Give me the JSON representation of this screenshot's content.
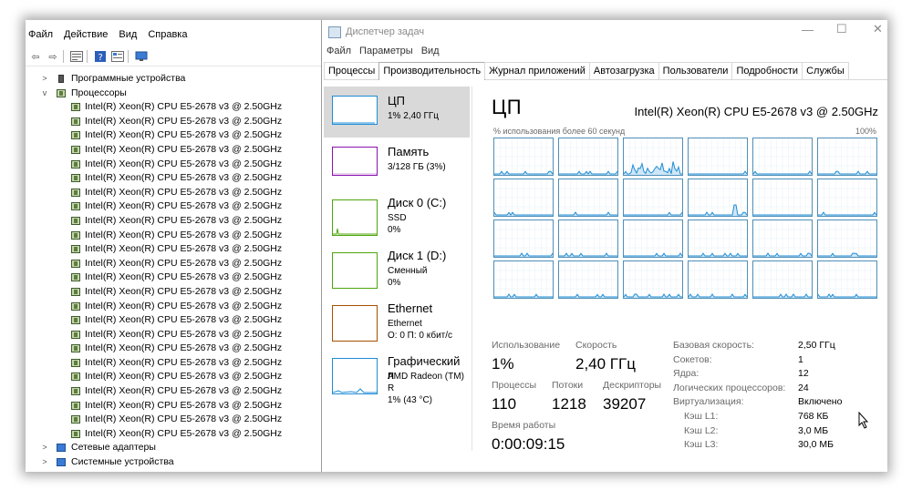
{
  "device_manager": {
    "menu": [
      "Файл",
      "Действие",
      "Вид",
      "Справка"
    ],
    "tree": {
      "programs": "Программные устройства",
      "processors_group": "Процессоры",
      "processors": [
        "Intel(R) Xeon(R) CPU E5-2678 v3 @ 2.50GHz",
        "Intel(R) Xeon(R) CPU E5-2678 v3 @ 2.50GHz",
        "Intel(R) Xeon(R) CPU E5-2678 v3 @ 2.50GHz",
        "Intel(R) Xeon(R) CPU E5-2678 v3 @ 2.50GHz",
        "Intel(R) Xeon(R) CPU E5-2678 v3 @ 2.50GHz",
        "Intel(R) Xeon(R) CPU E5-2678 v3 @ 2.50GHz",
        "Intel(R) Xeon(R) CPU E5-2678 v3 @ 2.50GHz",
        "Intel(R) Xeon(R) CPU E5-2678 v3 @ 2.50GHz",
        "Intel(R) Xeon(R) CPU E5-2678 v3 @ 2.50GHz",
        "Intel(R) Xeon(R) CPU E5-2678 v3 @ 2.50GHz",
        "Intel(R) Xeon(R) CPU E5-2678 v3 @ 2.50GHz",
        "Intel(R) Xeon(R) CPU E5-2678 v3 @ 2.50GHz",
        "Intel(R) Xeon(R) CPU E5-2678 v3 @ 2.50GHz",
        "Intel(R) Xeon(R) CPU E5-2678 v3 @ 2.50GHz",
        "Intel(R) Xeon(R) CPU E5-2678 v3 @ 2.50GHz",
        "Intel(R) Xeon(R) CPU E5-2678 v3 @ 2.50GHz",
        "Intel(R) Xeon(R) CPU E5-2678 v3 @ 2.50GHz",
        "Intel(R) Xeon(R) CPU E5-2678 v3 @ 2.50GHz",
        "Intel(R) Xeon(R) CPU E5-2678 v3 @ 2.50GHz",
        "Intel(R) Xeon(R) CPU E5-2678 v3 @ 2.50GHz",
        "Intel(R) Xeon(R) CPU E5-2678 v3 @ 2.50GHz",
        "Intel(R) Xeon(R) CPU E5-2678 v3 @ 2.50GHz",
        "Intel(R) Xeon(R) CPU E5-2678 v3 @ 2.50GHz",
        "Intel(R) Xeon(R) CPU E5-2678 v3 @ 2.50GHz"
      ],
      "network": "Сетевые адаптеры",
      "system": "Системные устройства"
    }
  },
  "task_manager": {
    "title": "Диспетчер задач",
    "menu": [
      "Файл",
      "Параметры",
      "Вид"
    ],
    "tabs": [
      "Процессы",
      "Производительность",
      "Журнал приложений",
      "Автозагрузка",
      "Пользователи",
      "Подробности",
      "Службы"
    ],
    "active_tab": "Производительность",
    "sidebar": [
      {
        "name": "ЦП",
        "sub1": "1% 2,40 ГГц",
        "sub2": "",
        "sub3": "",
        "color": "#1f8dd6"
      },
      {
        "name": "Память",
        "sub1": "3/128 ГБ (3%)",
        "sub2": "",
        "sub3": "",
        "color": "#8b12ae"
      },
      {
        "name": "Диск 0 (C:)",
        "sub1": "SSD",
        "sub2": "0%",
        "sub3": "",
        "color": "#4da60c"
      },
      {
        "name": "Диск 1 (D:)",
        "sub1": "Сменный",
        "sub2": "0%",
        "sub3": "",
        "color": "#4da60c"
      },
      {
        "name": "Ethernet",
        "sub1": "Ethernet",
        "sub2": "О: 0 П: 0 кбит/с",
        "sub3": "",
        "color": "#a74f01"
      },
      {
        "name": "Графический п",
        "sub1": "AMD Radeon (TM) R",
        "sub2": "1% (43 °C)",
        "sub3": "",
        "color": "#1f8dd6"
      }
    ],
    "cpu": {
      "title": "ЦП",
      "model": "Intel(R) Xeon(R) CPU E5-2678 v3 @ 2.50GHz",
      "usage_label": "% использования более 60 секунд",
      "usage_max": "100%",
      "cores": 24,
      "stats": {
        "usage_label": "Использование",
        "usage_value": "1%",
        "speed_label": "Скорость",
        "speed_value": "2,40 ГГц",
        "processes_label": "Процессы",
        "processes_value": "110",
        "threads_label": "Потоки",
        "threads_value": "1218",
        "handles_label": "Дескрипторы",
        "handles_value": "39207",
        "uptime_label": "Время работы",
        "uptime_value": "0:00:09:15"
      },
      "details": [
        {
          "label": "Базовая скорость:",
          "value": "2,50 ГГц"
        },
        {
          "label": "Сокетов:",
          "value": "1"
        },
        {
          "label": "Ядра:",
          "value": "12"
        },
        {
          "label": "Логических процессоров:",
          "value": "24"
        },
        {
          "label": "Виртуализация:",
          "value": "Включено"
        },
        {
          "label": "Кэш L1:",
          "value": "768 КБ"
        },
        {
          "label": "Кэш L2:",
          "value": "3,0 МБ"
        },
        {
          "label": "Кэш L3:",
          "value": "30,0 МБ"
        }
      ]
    }
  },
  "colors": {
    "cpu_line": "#1f8dd6",
    "cpu_border": "#4f8fb7",
    "cpu_fill": "#cfe6f6",
    "selected_bg": "#d9d9d9"
  }
}
